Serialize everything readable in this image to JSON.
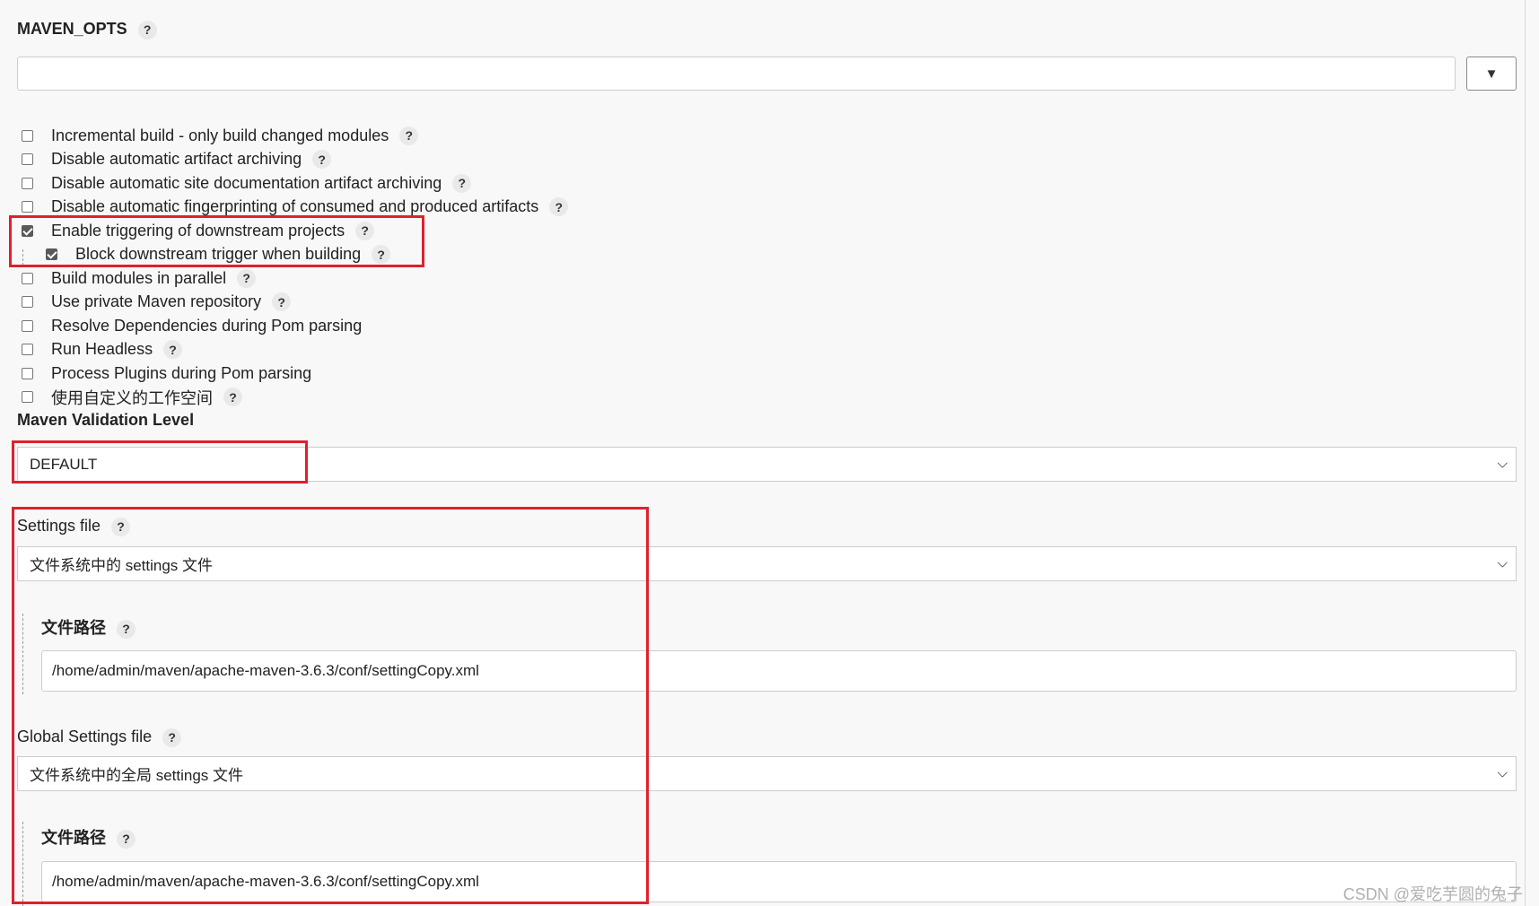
{
  "maven_opts": {
    "label": "MAVEN_OPTS",
    "value": "",
    "expand_icon": "▼"
  },
  "help_glyph": "?",
  "options": [
    {
      "label": "Incremental build - only build changed modules",
      "checked": false,
      "help": true,
      "sub": false
    },
    {
      "label": "Disable automatic artifact archiving",
      "checked": false,
      "help": true,
      "sub": false
    },
    {
      "label": "Disable automatic site documentation artifact archiving",
      "checked": false,
      "help": true,
      "sub": false
    },
    {
      "label": "Disable automatic fingerprinting of consumed and produced artifacts",
      "checked": false,
      "help": true,
      "sub": false
    },
    {
      "label": "Enable triggering of downstream projects",
      "checked": true,
      "help": true,
      "sub": false
    },
    {
      "label": "Block downstream trigger when building",
      "checked": true,
      "help": true,
      "sub": true
    },
    {
      "label": "Build modules in parallel",
      "checked": false,
      "help": true,
      "sub": false
    },
    {
      "label": "Use private Maven repository",
      "checked": false,
      "help": true,
      "sub": false
    },
    {
      "label": "Resolve Dependencies during Pom parsing",
      "checked": false,
      "help": false,
      "sub": false
    },
    {
      "label": "Run Headless",
      "checked": false,
      "help": true,
      "sub": false
    },
    {
      "label": "Process Plugins during Pom parsing",
      "checked": false,
      "help": false,
      "sub": false
    },
    {
      "label": "使用自定义的工作空间",
      "checked": false,
      "help": true,
      "sub": false
    }
  ],
  "validation": {
    "label": "Maven Validation Level",
    "selected": "DEFAULT"
  },
  "settings": {
    "label": "Settings file",
    "selected": "文件系统中的 settings 文件",
    "path_label": "文件路径",
    "path_value": "/home/admin/maven/apache-maven-3.6.3/conf/settingCopy.xml"
  },
  "global_settings": {
    "label": "Global Settings file",
    "selected": "文件系统中的全局 settings 文件",
    "path_label": "文件路径",
    "path_value": "/home/admin/maven/apache-maven-3.6.3/conf/settingCopy.xml"
  },
  "watermark": "CSDN @爱吃芋圆的兔子",
  "colors": {
    "highlight": "#e0202c",
    "background": "#f8f8f8"
  }
}
